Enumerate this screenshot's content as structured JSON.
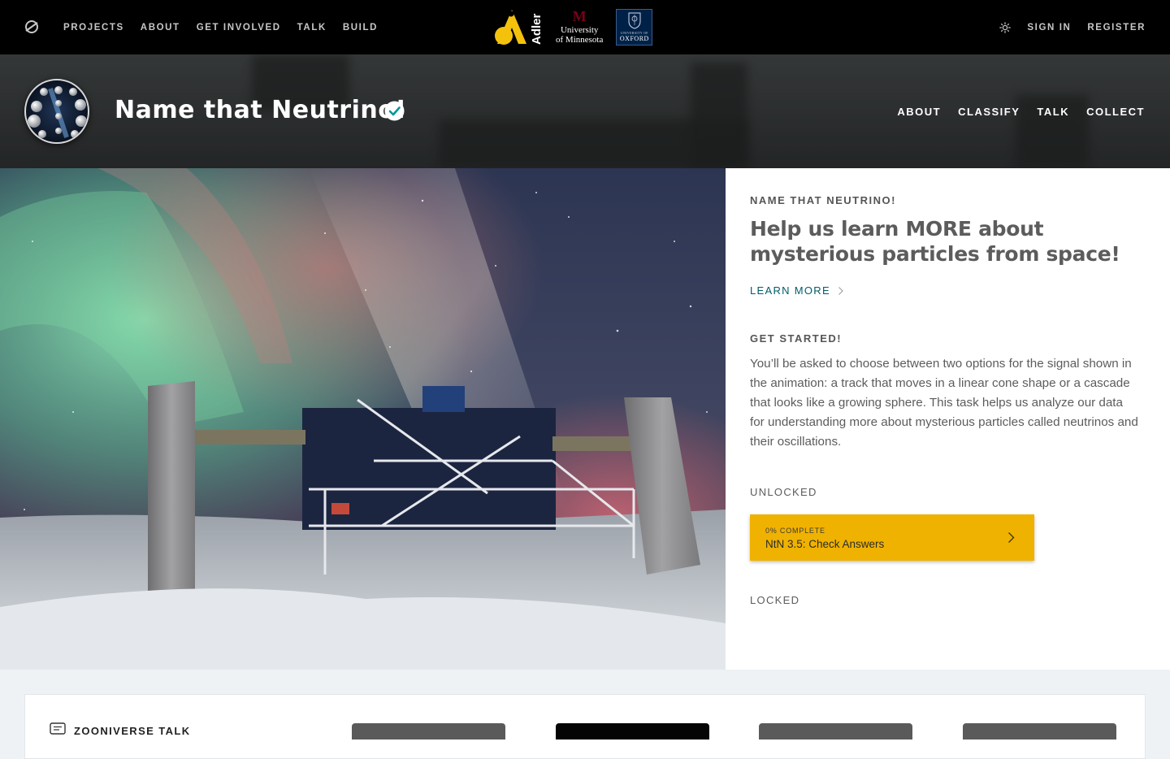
{
  "topnav": {
    "items": [
      "PROJECTS",
      "ABOUT",
      "GET INVOLVED",
      "TALK",
      "BUILD"
    ],
    "sign_in": "SIGN IN",
    "register": "REGISTER",
    "icons": {
      "logo": "zooniverse-logo-icon",
      "theme": "sun-icon"
    }
  },
  "partners": {
    "adler": "Adler",
    "umn_line1": "University",
    "umn_line2": "of Minnesota",
    "oxford_small": "UNIVERSITY OF",
    "oxford_big": "OXFORD"
  },
  "project": {
    "title": "Name that Neutrino!",
    "nav": [
      "ABOUT",
      "CLASSIFY",
      "TALK",
      "COLLECT"
    ]
  },
  "intro": {
    "kicker": "NAME THAT NEUTRINO!",
    "headline": "Help us learn MORE about mysterious particles from space!",
    "learn_more": "LEARN MORE",
    "get_started": "GET STARTED!",
    "body": "You’ll be asked to choose between two options for the signal shown in the animation: a track that moves in a linear cone shape or a cascade that looks like a growing sphere. This task helps us analyze our data for understanding more about mysterious particles called neutrinos and their oscillations.",
    "unlocked": "UNLOCKED",
    "workflow": {
      "progress": "0% COMPLETE",
      "name": "NtN 3.5: Check Answers"
    },
    "locked": "LOCKED"
  },
  "talk": {
    "title": "ZOONIVERSE TALK"
  },
  "colors": {
    "accent": "#f0b200",
    "link": "#005d69",
    "nav_bg": "#000000"
  }
}
